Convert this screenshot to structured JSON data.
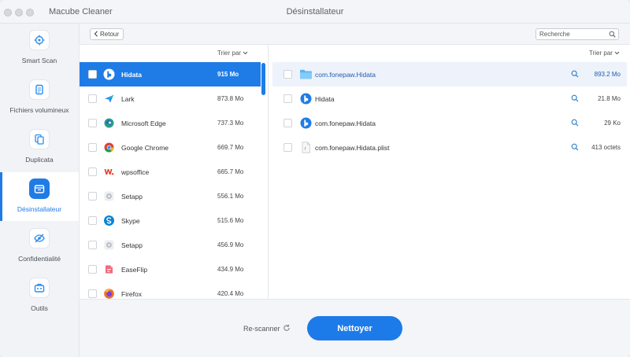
{
  "window": {
    "app_title": "Macube Cleaner",
    "title": "Désinstallateur"
  },
  "sidebar": {
    "items": [
      {
        "label": "Smart Scan",
        "icon": "target-icon",
        "active": false
      },
      {
        "label": "Fichiers volumineux",
        "icon": "file-icon",
        "active": false
      },
      {
        "label": "Duplicata",
        "icon": "duplicate-icon",
        "active": false
      },
      {
        "label": "Désinstallateur",
        "icon": "uninstall-icon",
        "active": true
      },
      {
        "label": "Confidentialité",
        "icon": "eye-slash-icon",
        "active": false
      },
      {
        "label": "Outils",
        "icon": "toolbox-icon",
        "active": false
      }
    ]
  },
  "toolbar": {
    "back_label": "Retour",
    "search_placeholder": "Recherche"
  },
  "apps": {
    "sort_label": "Trier par",
    "rows": [
      {
        "name": "Hidata",
        "size": "915 Mo",
        "icon": "hidata-icon",
        "selected": true
      },
      {
        "name": "Lark",
        "size": "873.8 Mo",
        "icon": "lark-icon",
        "selected": false
      },
      {
        "name": "Microsoft Edge",
        "size": "737.3 Mo",
        "icon": "edge-icon",
        "selected": false
      },
      {
        "name": "Google Chrome",
        "size": "669.7 Mo",
        "icon": "chrome-icon",
        "selected": false
      },
      {
        "name": "wpsoffice",
        "size": "665.7 Mo",
        "icon": "wps-icon",
        "selected": false
      },
      {
        "name": "Setapp",
        "size": "556.1 Mo",
        "icon": "setapp-icon",
        "selected": false
      },
      {
        "name": "Skype",
        "size": "515.6 Mo",
        "icon": "skype-icon",
        "selected": false
      },
      {
        "name": "Setapp",
        "size": "456.9 Mo",
        "icon": "setapp-icon",
        "selected": false
      },
      {
        "name": "EaseFlip",
        "size": "434.9 Mo",
        "icon": "easeflip-icon",
        "selected": false
      },
      {
        "name": "Firefox",
        "size": "420.4 Mo",
        "icon": "firefox-icon",
        "selected": false
      }
    ]
  },
  "files": {
    "sort_label": "Trier par",
    "rows": [
      {
        "name": "com.fonepaw.Hidata",
        "size": "893.2 Mo",
        "icon": "folder-icon",
        "highlighted": true
      },
      {
        "name": "Hidata",
        "size": "21.8 Mo",
        "icon": "hidata-icon",
        "highlighted": false
      },
      {
        "name": "com.fonepaw.Hidata",
        "size": "29 Ko",
        "icon": "hidata-icon",
        "highlighted": false
      },
      {
        "name": "com.fonepaw.Hidata.plist",
        "size": "413 octets",
        "icon": "plist-file-icon",
        "highlighted": false
      }
    ]
  },
  "footer": {
    "rescan_label": "Re-scanner",
    "clean_label": "Nettoyer"
  },
  "colors": {
    "accent": "#1f7ce6",
    "sidebar_bg": "#f1f3f7",
    "highlight": "#eef2fa"
  }
}
